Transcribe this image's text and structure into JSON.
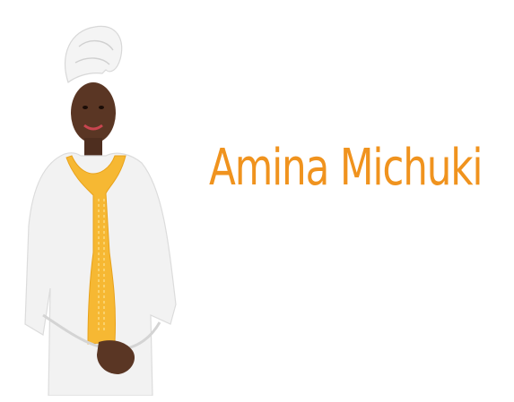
{
  "profile": {
    "name": "Amina Michuki"
  },
  "colors": {
    "accent": "#f0931e",
    "background": "#ffffff",
    "garment": "#f2f2f2",
    "embroidery": "#f6b833",
    "skin": "#5a3624"
  },
  "portrait": {
    "icon": "person-photo"
  }
}
